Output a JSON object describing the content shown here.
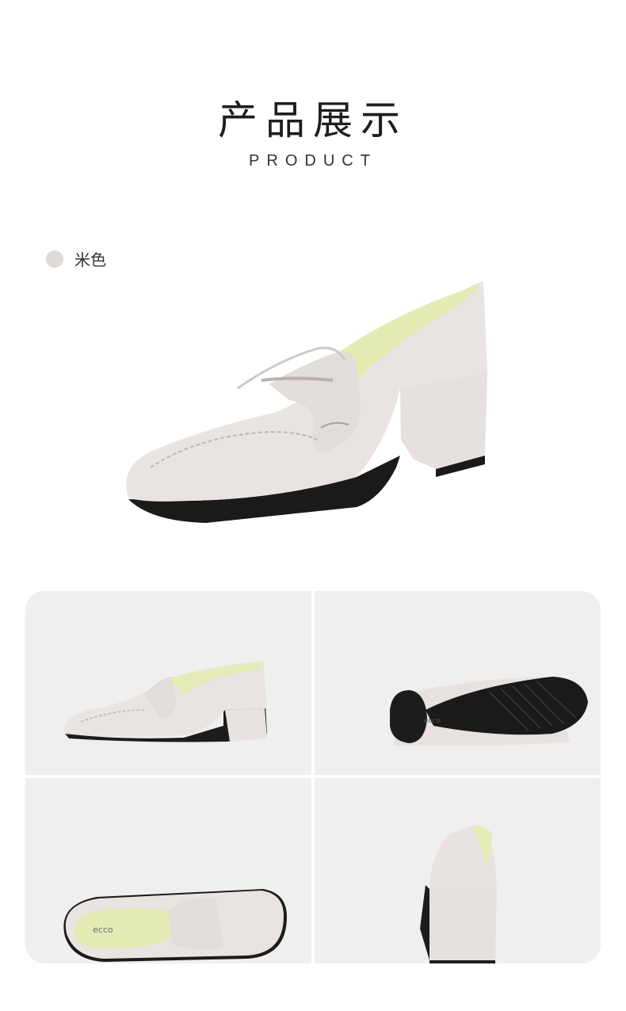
{
  "header": {
    "title": "产品展示",
    "subtitle": "PRODUCT"
  },
  "color_option": {
    "label": "米色",
    "swatch_color": "#dedad8"
  },
  "images": {
    "sole_brand": "ecco",
    "insole_brand": "ecco"
  },
  "colors": {
    "leather": "#e8e3e1",
    "lining": "#e6ecb8",
    "sole": "#1a1a1a",
    "panel_bg": "#efefef"
  }
}
